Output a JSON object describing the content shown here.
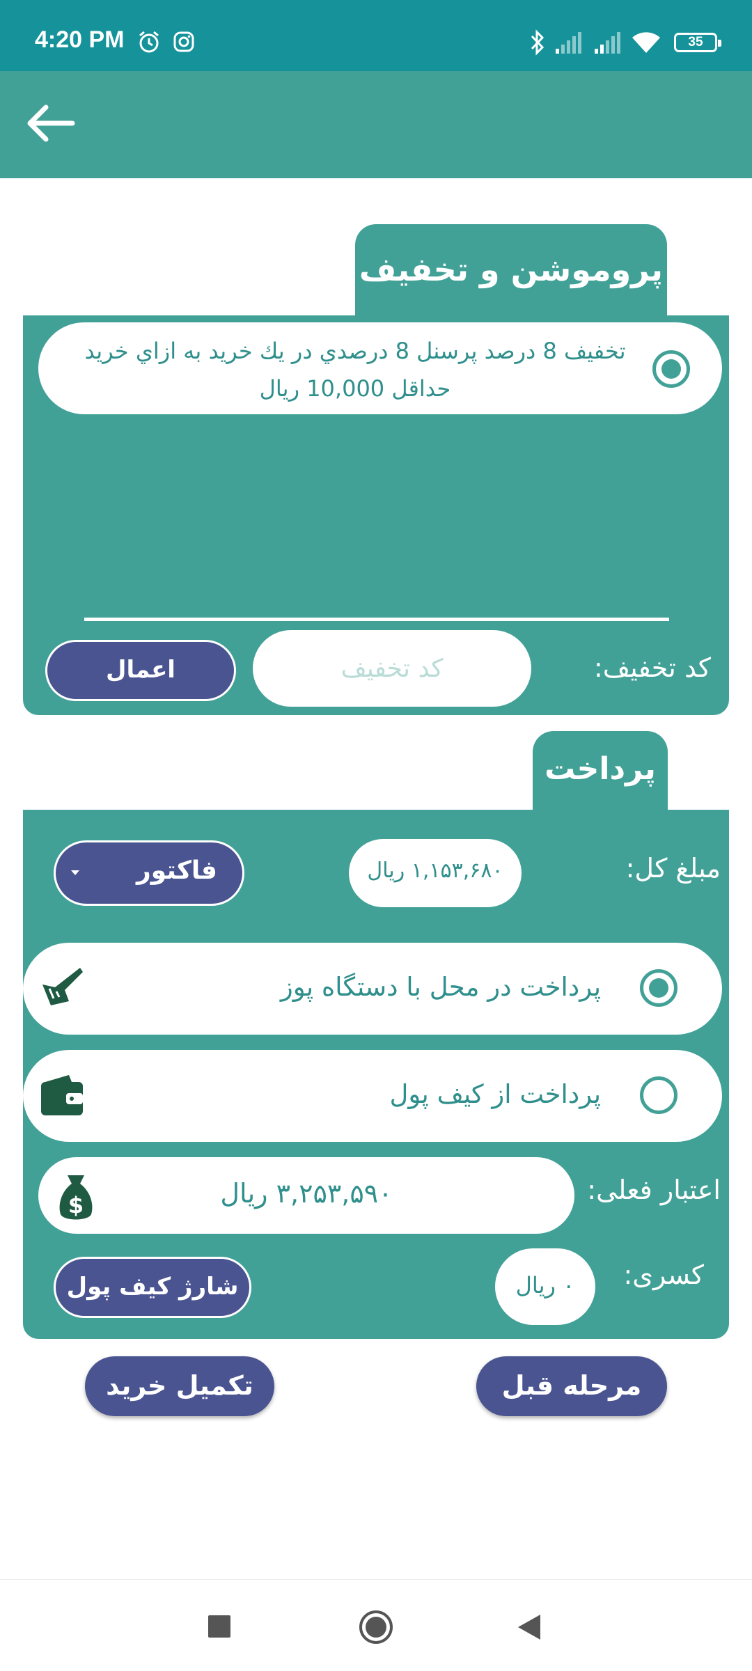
{
  "status_bar": {
    "time": "4:20 PM",
    "icons": [
      "alarm-icon",
      "instagram-icon",
      "bluetooth-icon",
      "signal-icon",
      "signal-icon",
      "wifi-icon"
    ],
    "battery": "35"
  },
  "app_bar": {
    "back_icon": "arrow-left-icon"
  },
  "promo": {
    "title": "پروموشن و تخفیف",
    "item_text": "تخفيف 8 درصد پرسنل 8 درصدي در يك خريد به ازاي خريد حداقل 10,000 ريال",
    "item_selected": true,
    "code_label": "کد تخفیف:",
    "code_placeholder": "کد تخفیف",
    "code_value": "",
    "apply_label": "اعمال"
  },
  "payment": {
    "title": "پرداخت",
    "total_label": "مبلغ کل:",
    "total_value": "۱,۱۵۳,۶۸۰ ریال",
    "invoice_label": "فاکتور",
    "methods": [
      {
        "label": "پرداخت در محل با دستگاه پوز",
        "selected": true,
        "icon": "pos-device-icon"
      },
      {
        "label": "پرداخت از کیف پول",
        "selected": false,
        "icon": "wallet-icon"
      }
    ],
    "credit_label": "اعتبار فعلی:",
    "credit_value": "۳,۲۵۳,۵۹۰ ریال",
    "deduction_label": "کسری:",
    "deduction_value": "۰ ریال",
    "charge_wallet_label": "شارژ کیف پول"
  },
  "actions": {
    "finish_label": "تکمیل خرید",
    "previous_label": "مرحله قبل"
  },
  "colors": {
    "status_bar": "#16939a",
    "primary": "#42a197",
    "text_teal": "#2f8f8c",
    "button": "#4a5491",
    "icon_dark": "#1f5a43"
  }
}
